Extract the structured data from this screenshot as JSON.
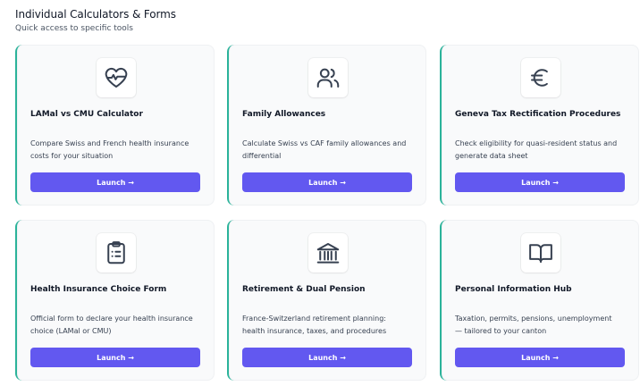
{
  "header": {
    "title": "Individual Calculators & Forms",
    "subtitle": "Quick access to specific tools"
  },
  "cards": [
    {
      "icon": "heart-pulse-icon",
      "title": "LAMal vs CMU Calculator",
      "description": "Compare Swiss and French health insurance costs for your situation",
      "button": "Launch →"
    },
    {
      "icon": "users-icon",
      "title": "Family Allowances",
      "description": "Calculate Swiss vs CAF family allowances and differential",
      "button": "Launch →"
    },
    {
      "icon": "euro-icon",
      "title": "Geneva Tax Rectification Procedures",
      "description": "Check eligibility for quasi-resident status and generate data sheet",
      "button": "Launch →"
    },
    {
      "icon": "clipboard-list-icon",
      "title": "Health Insurance Choice Form",
      "description": "Official form to declare your health insurance choice (LAMal or CMU)",
      "button": "Launch →"
    },
    {
      "icon": "bank-building-icon",
      "title": "Retirement & Dual Pension",
      "description": "France-Switzerland retirement planning: health insurance, taxes, and procedures",
      "button": "Launch →"
    },
    {
      "icon": "book-open-icon",
      "title": "Personal Information Hub",
      "description": "Taxation, permits, pensions, unemployment — tailored to your canton",
      "button": "Launch →"
    }
  ],
  "colors": {
    "accent_border": "#2bb39a",
    "button_bg": "#6258f0",
    "card_bg": "#f9fafb"
  }
}
